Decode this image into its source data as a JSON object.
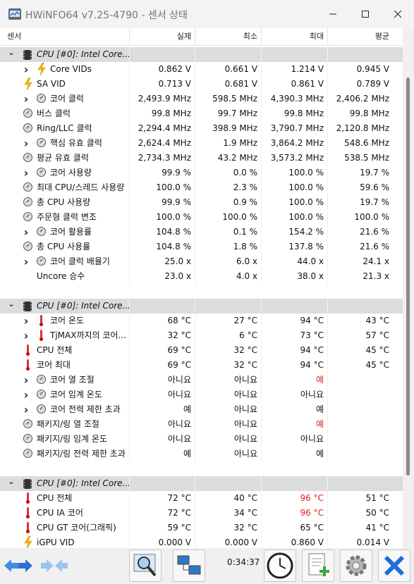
{
  "window": {
    "title": "HWiNFO64 v7.25-4790 - 센서 상태",
    "controls": {
      "minimize": "—",
      "maximize": "☐",
      "close": "✕"
    }
  },
  "columns": {
    "sensor": "센서",
    "current": "실제",
    "min": "최소",
    "max": "최대",
    "avg": "평균"
  },
  "groups": [
    {
      "title": "CPU [#0]: Intel Core..."
    },
    {
      "title": "CPU [#0]: Intel Core..."
    },
    {
      "title": "CPU [#0]: Intel Core..."
    }
  ],
  "rows": [
    {
      "label": "Core VIDs",
      "cur": "0.862 V",
      "min": "0.661 V",
      "max": "1.214 V",
      "avg": "0.945 V"
    },
    {
      "label": "SA VID",
      "cur": "0.713 V",
      "min": "0.681 V",
      "max": "0.861 V",
      "avg": "0.789 V"
    },
    {
      "label": "코어 클럭",
      "cur": "2,493.9 MHz",
      "min": "598.5 MHz",
      "max": "4,390.3 MHz",
      "avg": "2,406.2 MHz"
    },
    {
      "label": "버스 클럭",
      "cur": "99.8 MHz",
      "min": "99.7 MHz",
      "max": "99.8 MHz",
      "avg": "99.8 MHz"
    },
    {
      "label": "Ring/LLC 클럭",
      "cur": "2,294.4 MHz",
      "min": "398.9 MHz",
      "max": "3,790.7 MHz",
      "avg": "2,120.8 MHz"
    },
    {
      "label": "핵심 유효 클럭",
      "cur": "2,624.4 MHz",
      "min": "1.9 MHz",
      "max": "3,864.2 MHz",
      "avg": "548.6 MHz"
    },
    {
      "label": "평균 유효 클럭",
      "cur": "2,734.3 MHz",
      "min": "43.2 MHz",
      "max": "3,573.2 MHz",
      "avg": "538.5 MHz"
    },
    {
      "label": "코어 사용량",
      "cur": "99.9 %",
      "min": "0.0 %",
      "max": "100.0 %",
      "avg": "19.7 %"
    },
    {
      "label": "최대 CPU/스레드 사용량",
      "cur": "100.0 %",
      "min": "2.3 %",
      "max": "100.0 %",
      "avg": "59.6 %"
    },
    {
      "label": "총 CPU 사용량",
      "cur": "99.9 %",
      "min": "0.9 %",
      "max": "100.0 %",
      "avg": "19.7 %"
    },
    {
      "label": "주문형 클럭 변조",
      "cur": "100.0 %",
      "min": "100.0 %",
      "max": "100.0 %",
      "avg": "100.0 %"
    },
    {
      "label": "코어 활용률",
      "cur": "104.8 %",
      "min": "0.1 %",
      "max": "154.2 %",
      "avg": "21.6 %"
    },
    {
      "label": "총 CPU 사용률",
      "cur": "104.8 %",
      "min": "1.8 %",
      "max": "137.8 %",
      "avg": "21.6 %"
    },
    {
      "label": "코어 클럭 배율기",
      "cur": "25.0 x",
      "min": "6.0 x",
      "max": "44.0 x",
      "avg": "24.1 x"
    },
    {
      "label": "Uncore 승수",
      "cur": "23.0 x",
      "min": "4.0 x",
      "max": "38.0 x",
      "avg": "21.3 x"
    },
    {
      "label": "코어 온도",
      "cur": "68 °C",
      "min": "27 °C",
      "max": "94 °C",
      "avg": "43 °C"
    },
    {
      "label": "TjMAX까지의 코어...",
      "cur": "32 °C",
      "min": "6 °C",
      "max": "73 °C",
      "avg": "57 °C"
    },
    {
      "label": "CPU 전체",
      "cur": "69 °C",
      "min": "32 °C",
      "max": "94 °C",
      "avg": "45 °C"
    },
    {
      "label": "코어 최대",
      "cur": "69 °C",
      "min": "32 °C",
      "max": "94 °C",
      "avg": "45 °C"
    },
    {
      "label": "코어 열 조절",
      "cur": "아니요",
      "min": "아니요",
      "max": "예",
      "avg": ""
    },
    {
      "label": "코어 임계 온도",
      "cur": "아니요",
      "min": "아니요",
      "max": "아니요",
      "avg": ""
    },
    {
      "label": "코어 전력 제한 초과",
      "cur": "예",
      "min": "아니요",
      "max": "예",
      "avg": ""
    },
    {
      "label": "패키지/링 열 조절",
      "cur": "아니요",
      "min": "아니요",
      "max": "예",
      "avg": ""
    },
    {
      "label": "패키지/링 임계 온도",
      "cur": "아니요",
      "min": "아니요",
      "max": "아니요",
      "avg": ""
    },
    {
      "label": "패키지/링 전력 제한 초과",
      "cur": "예",
      "min": "아니요",
      "max": "예",
      "avg": ""
    },
    {
      "label": "CPU 전체",
      "cur": "72 °C",
      "min": "40 °C",
      "max": "96 °C",
      "avg": "51 °C"
    },
    {
      "label": "CPU IA 코어",
      "cur": "72 °C",
      "min": "34 °C",
      "max": "96 °C",
      "avg": "50 °C"
    },
    {
      "label": "CPU GT 코어(그래픽)",
      "cur": "59 °C",
      "min": "32 °C",
      "max": "65 °C",
      "avg": "41 °C"
    },
    {
      "label": "iGPU VID",
      "cur": "0.000 V",
      "min": "0.000 V",
      "max": "0.860 V",
      "avg": "0.014 V"
    }
  ],
  "footer": {
    "elapsed": "0:34:37"
  },
  "colors": {
    "alert": "#e11b1b",
    "group_bg": "#dcdcdc",
    "accent": "#2b7de9"
  }
}
